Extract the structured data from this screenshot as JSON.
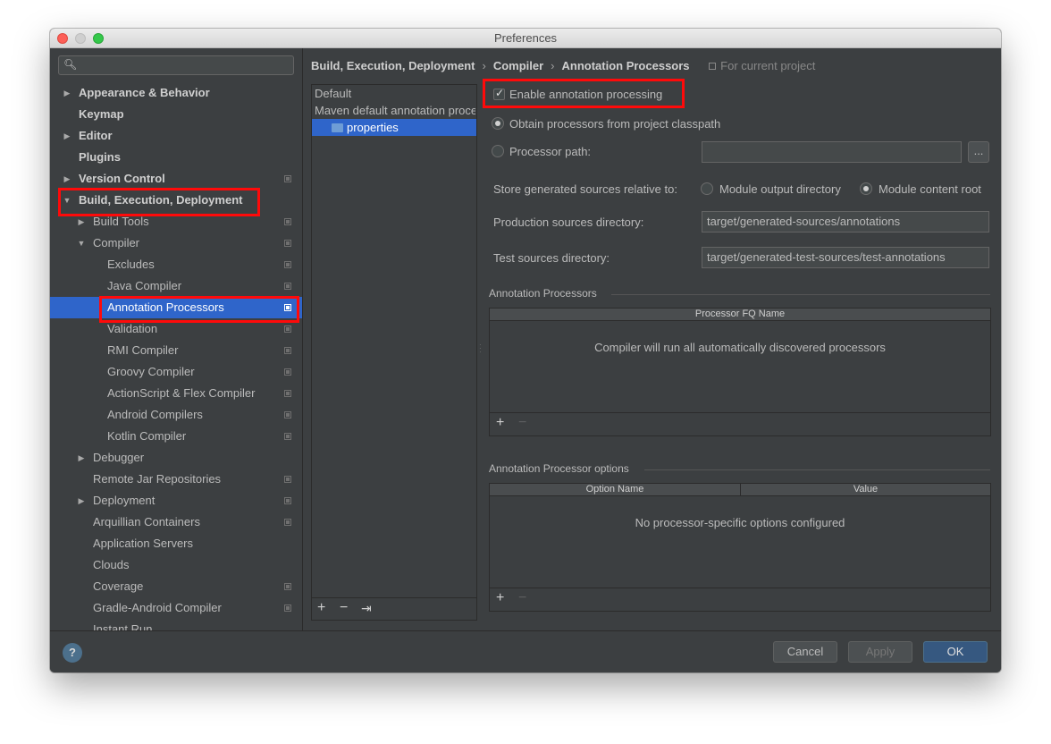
{
  "window": {
    "title": "Preferences"
  },
  "search": {
    "placeholder": ""
  },
  "sidebar": {
    "items": [
      {
        "label": "Appearance & Behavior",
        "bold": true,
        "arrow": "▶",
        "project": false
      },
      {
        "label": "Keymap",
        "bold": true,
        "arrow": "",
        "project": false
      },
      {
        "label": "Editor",
        "bold": true,
        "arrow": "▶",
        "project": false
      },
      {
        "label": "Plugins",
        "bold": true,
        "arrow": "",
        "project": false
      },
      {
        "label": "Version Control",
        "bold": true,
        "arrow": "▶",
        "project": true
      },
      {
        "label": "Build, Execution, Deployment",
        "bold": true,
        "arrow": "▼",
        "project": false
      },
      {
        "label": "Build Tools",
        "bold": false,
        "arrow": "▶",
        "project": true
      },
      {
        "label": "Compiler",
        "bold": false,
        "arrow": "▼",
        "project": true
      },
      {
        "label": "Excludes",
        "bold": false,
        "arrow": "",
        "project": true
      },
      {
        "label": "Java Compiler",
        "bold": false,
        "arrow": "",
        "project": true
      },
      {
        "label": "Annotation Processors",
        "bold": false,
        "arrow": "",
        "project": true,
        "selected": true
      },
      {
        "label": "Validation",
        "bold": false,
        "arrow": "",
        "project": true
      },
      {
        "label": "RMI Compiler",
        "bold": false,
        "arrow": "",
        "project": true
      },
      {
        "label": "Groovy Compiler",
        "bold": false,
        "arrow": "",
        "project": true
      },
      {
        "label": "ActionScript & Flex Compiler",
        "bold": false,
        "arrow": "",
        "project": true
      },
      {
        "label": "Android Compilers",
        "bold": false,
        "arrow": "",
        "project": true
      },
      {
        "label": "Kotlin Compiler",
        "bold": false,
        "arrow": "",
        "project": true
      },
      {
        "label": "Debugger",
        "bold": false,
        "arrow": "▶",
        "project": false
      },
      {
        "label": "Remote Jar Repositories",
        "bold": false,
        "arrow": "",
        "project": true
      },
      {
        "label": "Deployment",
        "bold": false,
        "arrow": "▶",
        "project": true
      },
      {
        "label": "Arquillian Containers",
        "bold": false,
        "arrow": "",
        "project": true
      },
      {
        "label": "Application Servers",
        "bold": false,
        "arrow": "",
        "project": false
      },
      {
        "label": "Clouds",
        "bold": false,
        "arrow": "",
        "project": false
      },
      {
        "label": "Coverage",
        "bold": false,
        "arrow": "",
        "project": true
      },
      {
        "label": "Gradle-Android Compiler",
        "bold": false,
        "arrow": "",
        "project": true
      },
      {
        "label": "Instant Run",
        "bold": false,
        "arrow": "",
        "project": false
      }
    ]
  },
  "breadcrumb": {
    "parts": [
      "Build, Execution, Deployment",
      "Compiler",
      "Annotation Processors"
    ],
    "separator": "›",
    "scope": "For current project"
  },
  "profiles": {
    "items": [
      "Default",
      "Maven default annotation processors profile",
      "properties"
    ],
    "toolbar": {
      "add": "+",
      "remove": "−",
      "move": "⇥"
    }
  },
  "settings": {
    "enable_label": "Enable annotation processing",
    "enable_checked": true,
    "obtain_label": "Obtain processors from project classpath",
    "processor_path_label": "Processor path:",
    "processor_path_value": "",
    "browse_label": "...",
    "store_label": "Store generated sources relative to:",
    "store_options": [
      "Module output directory",
      "Module content root"
    ],
    "production_label": "Production sources directory:",
    "production_value": "target/generated-sources/annotations",
    "test_label": "Test sources directory:",
    "test_value": "target/generated-test-sources/test-annotations"
  },
  "processors_table": {
    "title": "Annotation Processors",
    "columns": [
      "Processor FQ Name"
    ],
    "empty": "Compiler will run all automatically discovered processors",
    "add": "+",
    "remove": "−"
  },
  "options_table": {
    "title": "Annotation Processor options",
    "columns": [
      "Option Name",
      "Value"
    ],
    "empty": "No processor-specific options configured",
    "add": "+",
    "remove": "−"
  },
  "footer": {
    "help": "?",
    "cancel": "Cancel",
    "apply": "Apply",
    "ok": "OK"
  },
  "colors": {
    "accent": "#2f65ca",
    "highlight": "#ff0a0a",
    "background": "#3c3f41"
  }
}
